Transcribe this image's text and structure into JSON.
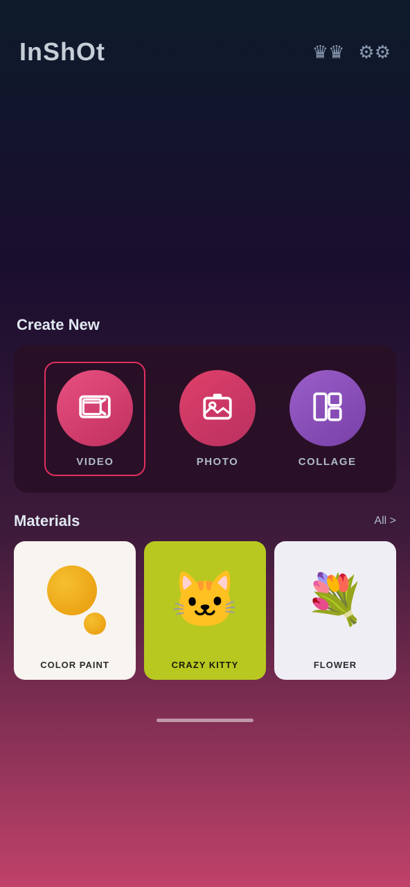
{
  "header": {
    "logo": "InShOt",
    "crown_icon": "♛",
    "gear_icon": "⚙"
  },
  "create_new": {
    "section_title": "Create New",
    "items": [
      {
        "id": "video",
        "label": "VIDEO",
        "selected": true
      },
      {
        "id": "photo",
        "label": "PHOTO",
        "selected": false
      },
      {
        "id": "collage",
        "label": "COLLAGE",
        "selected": false
      }
    ]
  },
  "materials": {
    "section_title": "Materials",
    "all_label": "All >",
    "items": [
      {
        "id": "color-paint",
        "label": "COLOR PAINT",
        "theme": "color-paint"
      },
      {
        "id": "crazy-kitty",
        "label": "CRAZY KITTY",
        "theme": "crazy-kitty"
      },
      {
        "id": "flower",
        "label": "FLOWER",
        "theme": "flower"
      }
    ]
  },
  "bottom": {
    "home_indicator": ""
  }
}
